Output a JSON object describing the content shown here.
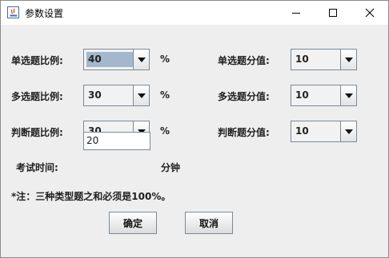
{
  "window": {
    "title": "参数设置",
    "icons": [
      "java-app-icon",
      "minimize-icon",
      "maximize-icon",
      "close-icon"
    ]
  },
  "rows": [
    {
      "left_label": "单选题比例:",
      "left_value": "40",
      "unit": "%",
      "right_label": "单选题分值:",
      "right_value": "10"
    },
    {
      "left_label": "多选题比例:",
      "left_value": "30",
      "unit": "%",
      "right_label": "多选题分值:",
      "right_value": "10"
    },
    {
      "left_label": "判断题比例:",
      "left_value": "30",
      "unit": "%",
      "right_label": "判断题分值:",
      "right_value": "10"
    }
  ],
  "exam_time": {
    "label": "考试时间:",
    "value": "20",
    "unit": "分钟"
  },
  "note": "*注：三种类型题之和必须是100%。",
  "buttons": {
    "confirm": "确定",
    "cancel": "取消"
  },
  "colors": {
    "selected_highlight": "#a3b8cc",
    "background": "#eeeeee"
  }
}
